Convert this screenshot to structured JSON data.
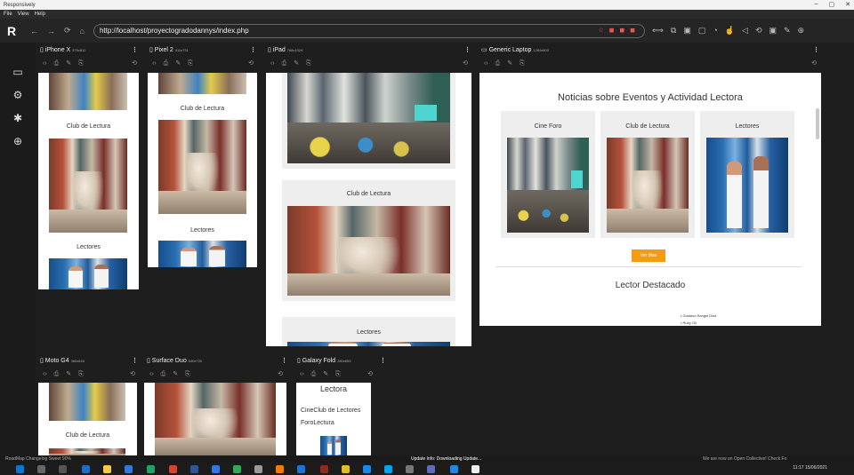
{
  "app": {
    "title": "Responsively",
    "menu": [
      "File",
      "View",
      "Help"
    ],
    "window_controls": [
      "–",
      "▢",
      "✕"
    ]
  },
  "toolbar": {
    "url": "http://localhost/proyectogradodannys/index.php",
    "nav": [
      "←",
      "→",
      "⟳",
      "⌂"
    ],
    "url_right_icons": "☆ ◼ ◼ ◼",
    "tools": [
      "⟺",
      "⧉",
      "▣",
      "▢",
      "◔",
      "☝",
      "◁",
      "⟲",
      "▣",
      "✎",
      "⊕"
    ]
  },
  "sidebar": {
    "icons": [
      "devices-icon",
      "gear-icon",
      "puzzle-icon",
      "globe-icon"
    ],
    "glyphs": [
      "▭",
      "⚙",
      "✱",
      "⊕"
    ]
  },
  "devices": {
    "iphone": {
      "name": "iPhone X",
      "size": "375x812",
      "labels": [
        "Club de Lectura",
        "Lectores"
      ]
    },
    "pixel": {
      "name": "Pixel 2",
      "size": "411x731",
      "labels": [
        "Club de Lectura",
        "Lectores"
      ]
    },
    "ipad": {
      "name": "iPad",
      "size": "768x1024",
      "labels": [
        "Club de Lectura",
        "Lectores"
      ]
    },
    "laptop": {
      "name": "Generic Laptop",
      "size": "1280x800",
      "heading": "Noticias sobre Eventos y Actividad Lectora",
      "cards": [
        "Cine Foro",
        "Club de Lectura",
        "Lectores"
      ],
      "button": "Ver Mas",
      "section": "Lector Destacado",
      "bullets": [
        "Gustavo Rangel Diaz",
        "Ruby Gil"
      ]
    },
    "moto": {
      "name": "Moto G4",
      "size": "360x640",
      "labels": [
        "Club de Lectura"
      ]
    },
    "duo": {
      "name": "Surface Duo",
      "size": "540x720"
    },
    "fold": {
      "name": "Galaxy Fold",
      "size": "280x653",
      "texts": [
        "Lectora",
        "CineClub de Lectores",
        "ForoLectura"
      ]
    }
  },
  "device_tools": [
    "‹›",
    "⎙",
    "✎",
    "⎘"
  ],
  "rotate_glyph": "⟲",
  "menu_glyph": "⋮",
  "statusbar": {
    "left": "RoadMap   Changelog   Sweet  90%",
    "center": "Update Info: Downloading Update...",
    "right": "We are now on Open Collective! Check Fo"
  },
  "taskbar": {
    "clock": "11:17",
    "date": "15/06/2021"
  }
}
